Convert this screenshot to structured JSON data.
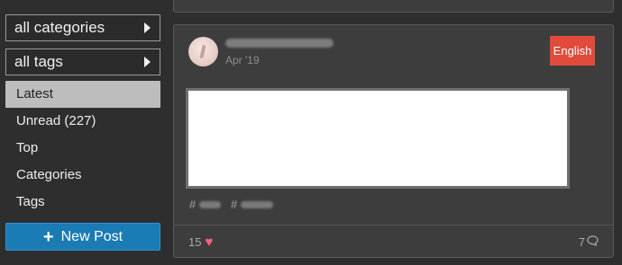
{
  "sidebar": {
    "categories_dropdown": "all categories",
    "tags_dropdown": "all tags",
    "nav_items": [
      {
        "label": "Latest",
        "active": true
      },
      {
        "label": "Unread (227)",
        "active": false
      },
      {
        "label": "Top",
        "active": false
      },
      {
        "label": "Categories",
        "active": false
      },
      {
        "label": "Tags",
        "active": false
      }
    ],
    "new_post_label": "New Post",
    "new_post_icon": "plus-icon",
    "accent_color": "#1b7bb5"
  },
  "post": {
    "date": "Apr '19",
    "language_badge": "English",
    "badge_color": "#e14b3b",
    "likes": "15",
    "replies": "7",
    "like_icon": "heart-icon",
    "reply_icon": "comment-icon"
  }
}
